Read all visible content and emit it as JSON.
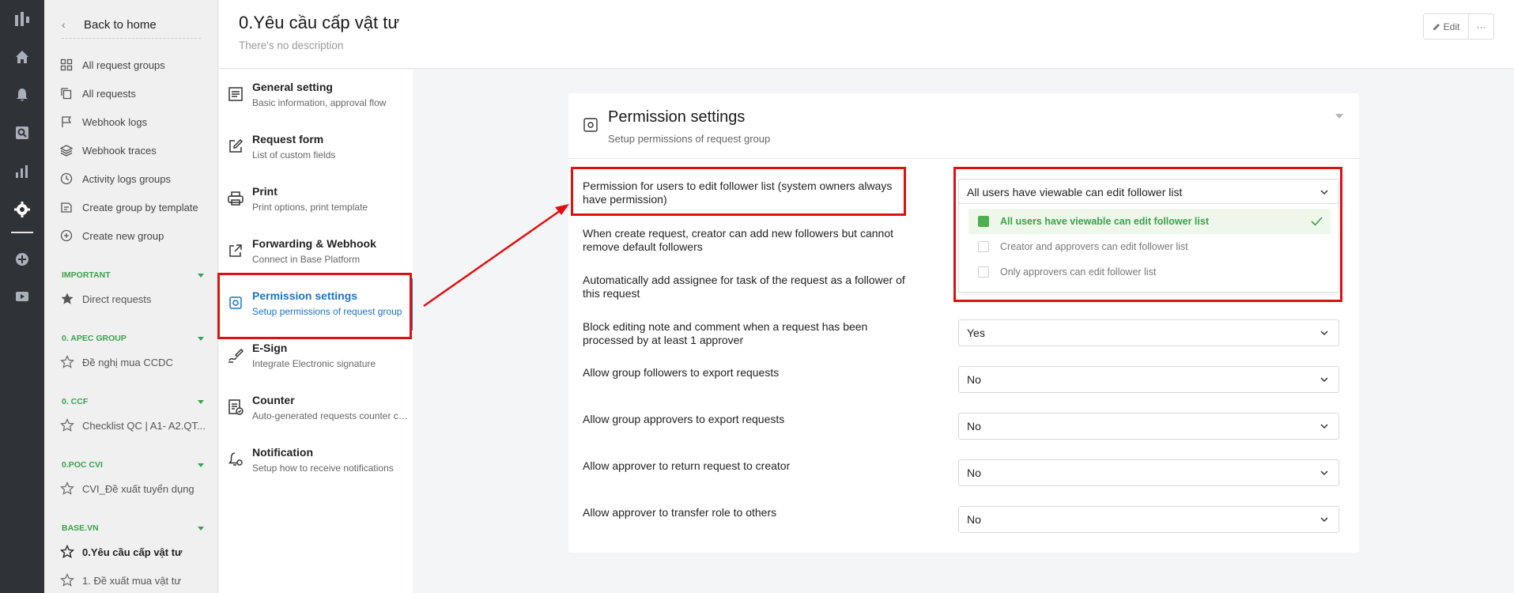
{
  "rail": {
    "icons": [
      "logo-icon",
      "home-icon",
      "bell-icon",
      "search-icon",
      "chart-icon",
      "gear-icon",
      "plus-circle-icon",
      "play-icon"
    ]
  },
  "sidebar": {
    "back_label": "Back to home",
    "nav": [
      {
        "label": "All request groups",
        "icon": "grid-icon"
      },
      {
        "label": "All requests",
        "icon": "copy-icon"
      },
      {
        "label": "Webhook logs",
        "icon": "flag-icon"
      },
      {
        "label": "Webhook traces",
        "icon": "layers-icon"
      },
      {
        "label": "Activity logs groups",
        "icon": "clock-icon"
      },
      {
        "label": "Create group by template",
        "icon": "template-icon"
      },
      {
        "label": "Create new group",
        "icon": "plus-circle-icon"
      }
    ],
    "sections": [
      {
        "title": "IMPORTANT",
        "items": [
          {
            "label": "Direct requests",
            "icon": "star-filled-icon"
          }
        ]
      },
      {
        "title": "0. APEC GROUP",
        "items": [
          {
            "label": "Đề nghị mua CCDC",
            "icon": "star-outline-icon"
          }
        ]
      },
      {
        "title": "0. CCF",
        "items": [
          {
            "label": "Checklist QC | A1- A2.QT...",
            "icon": "star-outline-icon"
          }
        ]
      },
      {
        "title": "0.POC CVI",
        "items": [
          {
            "label": "CVI_Đề xuất tuyển dụng",
            "icon": "star-outline-icon"
          }
        ]
      },
      {
        "title": "BASE.VN",
        "items": [
          {
            "label": "0.Yêu cầu cấp vật tư",
            "icon": "star-outline-icon",
            "active": true
          },
          {
            "label": "1. Đề xuất mua vật tư",
            "icon": "star-outline-icon"
          }
        ]
      }
    ]
  },
  "header": {
    "title": "0.Yêu cầu cấp vật tư",
    "description": "There's no description",
    "edit_label": "Edit",
    "more_label": "···"
  },
  "settings_menu": [
    {
      "title": "General setting",
      "subtitle": "Basic information, approval flow",
      "icon": "document-icon"
    },
    {
      "title": "Request form",
      "subtitle": "List of custom fields",
      "icon": "edit-icon"
    },
    {
      "title": "Print",
      "subtitle": "Print options, print template",
      "icon": "printer-icon"
    },
    {
      "title": "Forwarding & Webhook",
      "subtitle": "Connect in Base Platform",
      "icon": "share-icon"
    },
    {
      "title": "Permission settings",
      "subtitle": "Setup permissions of request group",
      "icon": "gear-icon",
      "active": true
    },
    {
      "title": "E-Sign",
      "subtitle": "Integrate Electronic signature",
      "icon": "signature-icon"
    },
    {
      "title": "Counter",
      "subtitle": "Auto-generated requests counter config",
      "icon": "counter-icon"
    },
    {
      "title": "Notification",
      "subtitle": "Setup how to receive notifications",
      "icon": "bell-gear-icon"
    }
  ],
  "permission_card": {
    "title": "Permission settings",
    "subtitle": "Setup permissions of request group",
    "rows": [
      {
        "label": "Permission for users to edit follower list (system owners always have permission)",
        "value": "All users have viewable can edit follower list"
      },
      {
        "label": "When create request, creator can add new followers but cannot remove default followers",
        "value": ""
      },
      {
        "label": "Automatically add assignee for task of the request as a follower of this request",
        "value": ""
      },
      {
        "label": "Block editing note and comment when a request has been processed by at least 1 approver",
        "value": "Yes"
      },
      {
        "label": "Allow group followers to export requests",
        "value": "No"
      },
      {
        "label": "Allow group approvers to export requests",
        "value": "No"
      },
      {
        "label": "Allow approver to return request to creator",
        "value": "No"
      },
      {
        "label": "Allow approver to transfer role to others",
        "value": "No"
      }
    ],
    "dropdown_options": [
      {
        "label": "All users have viewable can edit follower list",
        "selected": true
      },
      {
        "label": "Creator and approvers can edit follower list",
        "selected": false
      },
      {
        "label": "Only approvers can edit follower list",
        "selected": false
      }
    ]
  },
  "colors": {
    "rail": "#2f3338",
    "accent_blue": "#1a73c8",
    "accent_green": "#3aa24a",
    "annotation_red": "#e01010"
  }
}
